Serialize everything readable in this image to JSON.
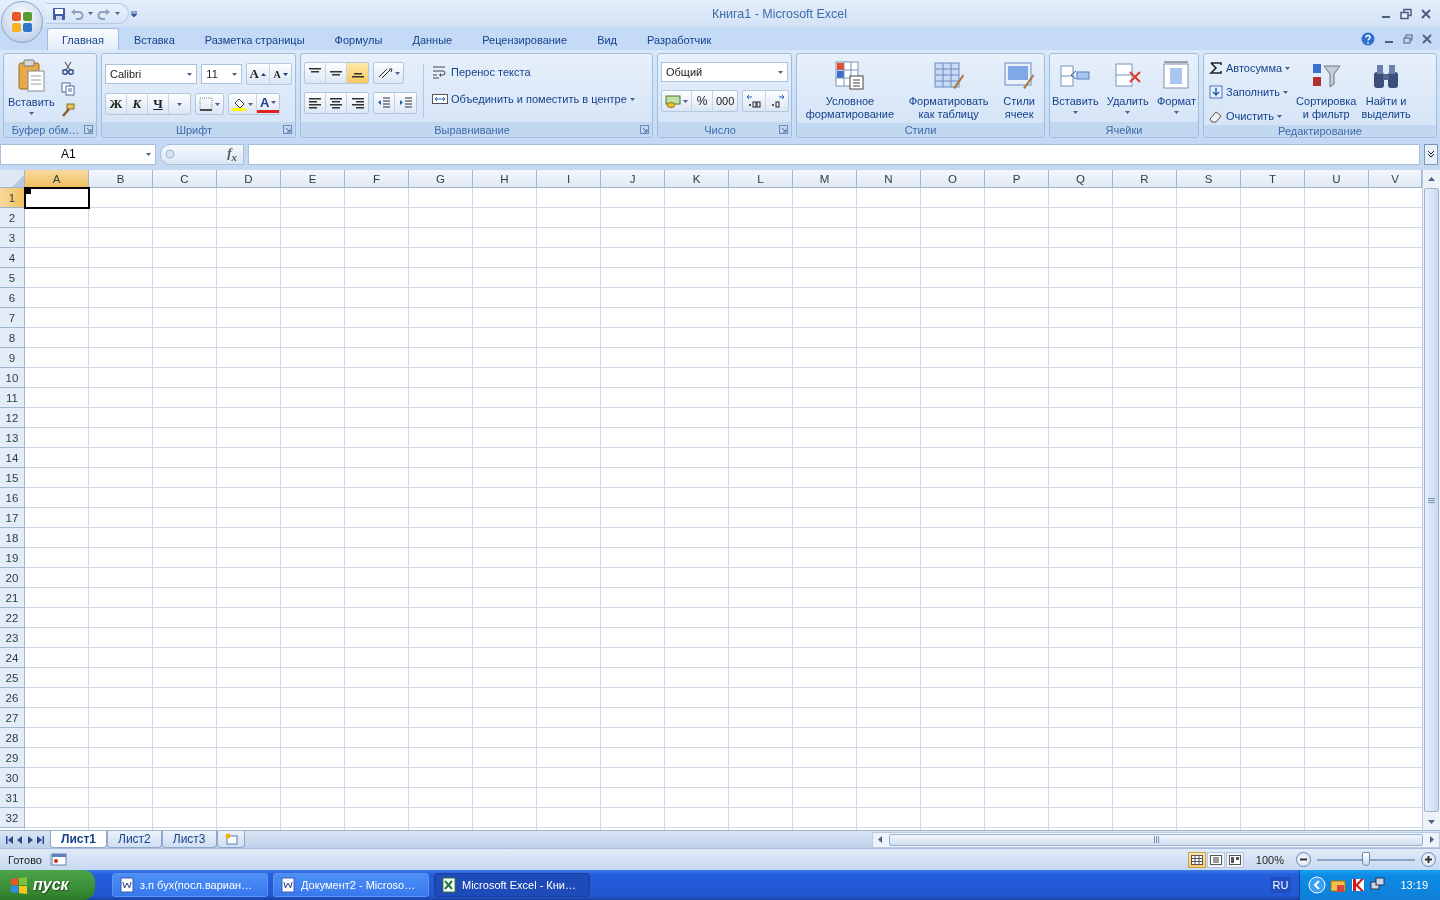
{
  "window": {
    "title": "Книга1 - Microsoft Excel"
  },
  "tabs": [
    {
      "label": "Главная",
      "selected": true
    },
    {
      "label": "Вставка",
      "selected": false
    },
    {
      "label": "Разметка страницы",
      "selected": false
    },
    {
      "label": "Формулы",
      "selected": false
    },
    {
      "label": "Данные",
      "selected": false
    },
    {
      "label": "Рецензирование",
      "selected": false
    },
    {
      "label": "Вид",
      "selected": false
    },
    {
      "label": "Разработчик",
      "selected": false
    }
  ],
  "clipboard": {
    "paste": "Вставить",
    "label": "Буфер обм…"
  },
  "font": {
    "name": "Calibri",
    "size": "11",
    "grow": "A",
    "shrink": "A",
    "bold": "Ж",
    "italic": "К",
    "underline": "Ч",
    "color_label": "A",
    "label": "Шрифт"
  },
  "alignment": {
    "vertical": [
      {
        "kind": "top",
        "selected": false
      },
      {
        "kind": "middle",
        "selected": false
      },
      {
        "kind": "bottom",
        "selected": true
      }
    ],
    "horizontal": [
      {
        "kind": "left"
      },
      {
        "kind": "center"
      },
      {
        "kind": "right"
      }
    ],
    "wrap": "Перенос текста",
    "merge": "Объединить и поместить в центре",
    "label": "Выравнивание"
  },
  "number": {
    "format": "Общий",
    "percent": "%",
    "thousands": "000",
    "label": "Число"
  },
  "styles": {
    "buttons": [
      {
        "kind": "conditional",
        "lines": [
          "Условное",
          "форматирование"
        ]
      },
      {
        "kind": "table",
        "lines": [
          "Форматировать",
          "как таблицу"
        ]
      },
      {
        "kind": "cellstyles",
        "lines": [
          "Стили",
          "ячеек"
        ]
      }
    ],
    "label": "Стили"
  },
  "cells": {
    "buttons": [
      {
        "kind": "insert",
        "label": "Вставить"
      },
      {
        "kind": "delete",
        "label": "Удалить"
      },
      {
        "kind": "format",
        "label": "Формат"
      }
    ],
    "label": "Ячейки"
  },
  "editing": {
    "small": [
      {
        "kind": "autosum",
        "label": "Автосумма"
      },
      {
        "kind": "fill",
        "label": "Заполнить"
      },
      {
        "kind": "clear",
        "label": "Очистить"
      }
    ],
    "big": [
      {
        "kind": "sort",
        "lines": [
          "Сортировка",
          "и фильтр"
        ]
      },
      {
        "kind": "find",
        "lines": [
          "Найти и",
          "выделить"
        ]
      }
    ],
    "label": "Редактирование"
  },
  "formula_bar": {
    "name_box": "A1",
    "function_label": "f$_{x}$"
  },
  "sheet": {
    "columns": [
      {
        "label": "A",
        "selected": true
      },
      {
        "label": "B",
        "selected": false
      },
      {
        "label": "C",
        "selected": false
      },
      {
        "label": "D",
        "selected": false
      },
      {
        "label": "E",
        "selected": false
      },
      {
        "label": "F",
        "selected": false
      },
      {
        "label": "G",
        "selected": false
      },
      {
        "label": "H",
        "selected": false
      },
      {
        "label": "I",
        "selected": false
      },
      {
        "label": "J",
        "selected": false
      },
      {
        "label": "K",
        "selected": false
      },
      {
        "label": "L",
        "selected": false
      },
      {
        "label": "M",
        "selected": false
      },
      {
        "label": "N",
        "selected": false
      },
      {
        "label": "O",
        "selected": false
      },
      {
        "label": "P",
        "selected": false
      },
      {
        "label": "Q",
        "selected": false
      },
      {
        "label": "R",
        "selected": false
      },
      {
        "label": "S",
        "selected": false
      },
      {
        "label": "T",
        "selected": false
      },
      {
        "label": "U",
        "selected": false
      },
      {
        "label": "V",
        "selected": false
      }
    ],
    "rows": [
      {
        "label": "1",
        "selected": true
      },
      {
        "label": "2",
        "selected": false
      },
      {
        "label": "3",
        "selected": false
      },
      {
        "label": "4",
        "selected": false
      },
      {
        "label": "5",
        "selected": false
      },
      {
        "label": "6",
        "selected": false
      },
      {
        "label": "7",
        "selected": false
      },
      {
        "label": "8",
        "selected": false
      },
      {
        "label": "9",
        "selected": false
      },
      {
        "label": "10",
        "selected": false
      },
      {
        "label": "11",
        "selected": false
      },
      {
        "label": "12",
        "selected": false
      },
      {
        "label": "13",
        "selected": false
      },
      {
        "label": "14",
        "selected": false
      },
      {
        "label": "15",
        "selected": false
      },
      {
        "label": "16",
        "selected": false
      },
      {
        "label": "17",
        "selected": false
      },
      {
        "label": "18",
        "selected": false
      },
      {
        "label": "19",
        "selected": false
      },
      {
        "label": "20",
        "selected": false
      },
      {
        "label": "21",
        "selected": false
      },
      {
        "label": "22",
        "selected": false
      },
      {
        "label": "23",
        "selected": false
      },
      {
        "label": "24",
        "selected": false
      },
      {
        "label": "25",
        "selected": false
      },
      {
        "label": "26",
        "selected": false
      },
      {
        "label": "27",
        "selected": false
      },
      {
        "label": "28",
        "selected": false
      },
      {
        "label": "29",
        "selected": false
      },
      {
        "label": "30",
        "selected": false
      },
      {
        "label": "31",
        "selected": false
      },
      {
        "label": "32",
        "selected": false
      }
    ]
  },
  "sheet_tabs": [
    {
      "label": "Лист1",
      "selected": true
    },
    {
      "label": "Лист2",
      "selected": false
    },
    {
      "label": "Лист3",
      "selected": false
    }
  ],
  "status_bar": {
    "status": "Готово",
    "views": [
      {
        "kind": "normal",
        "selected": true
      },
      {
        "kind": "layout",
        "selected": false
      },
      {
        "kind": "pagebreak",
        "selected": false
      }
    ],
    "zoom": "100%",
    "zoom_slider": {
      "level": 0.5
    }
  },
  "taskbar": {
    "start": "пуск",
    "windows": [
      {
        "kind": "word",
        "label": "з.п бух(посл.вариан…",
        "selected": false
      },
      {
        "kind": "word",
        "label": "Документ2 - Microso…",
        "selected": false
      },
      {
        "kind": "excel",
        "label": "Microsoft Excel - Кни…",
        "selected": true
      }
    ],
    "language": "RU",
    "clock": "13:19"
  }
}
